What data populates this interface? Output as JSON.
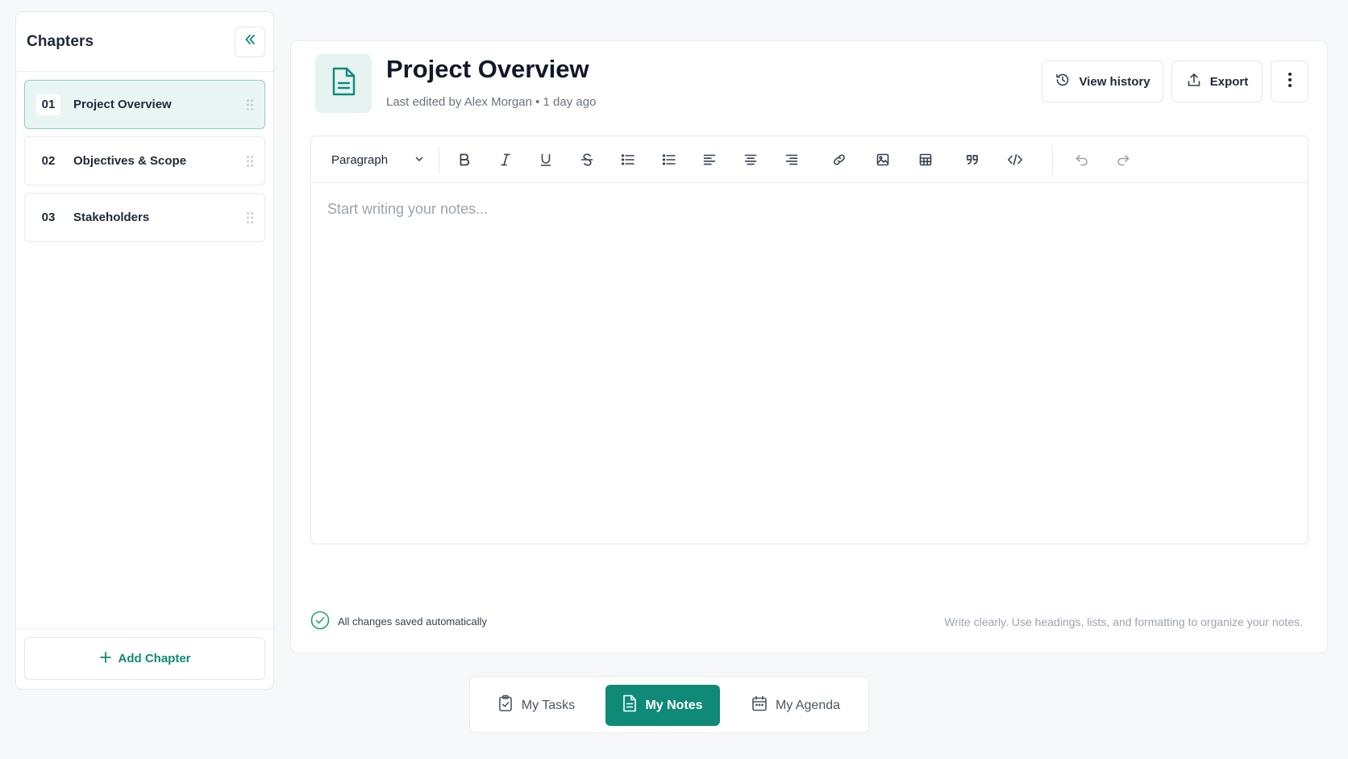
{
  "colors": {
    "accent": "#0f8a78",
    "accent_light": "#e8f5f2",
    "success": "#22a46f"
  },
  "sidebar": {
    "title": "Chapters",
    "collapse_icon": "double-chevron-left-icon",
    "chapters": [
      {
        "num": "01",
        "label": "Project Overview",
        "active": true
      },
      {
        "num": "02",
        "label": "Objectives & Scope",
        "active": false
      },
      {
        "num": "03",
        "label": "Stakeholders",
        "active": false
      }
    ],
    "add_label": "Add Chapter"
  },
  "document": {
    "title": "Project Overview",
    "meta": "Last edited by Alex Morgan • 1 day ago",
    "view_history_label": "View history",
    "export_label": "Export"
  },
  "editor": {
    "block_type": "Paragraph",
    "placeholder": "Start writing your notes...",
    "tools": [
      "bold-icon",
      "italic-icon",
      "underline-icon",
      "strikethrough-icon",
      "bullet-list-icon",
      "numbered-list-icon",
      "align-left-icon",
      "align-center-icon",
      "align-right-icon",
      "link-icon",
      "image-icon",
      "table-icon",
      "quote-icon",
      "code-icon",
      "undo-icon",
      "redo-icon"
    ]
  },
  "status": {
    "saved": "All changes saved automatically",
    "hint": "Write clearly. Use headings, lists, and formatting to organize your notes."
  },
  "bottom_nav": {
    "items": [
      {
        "label": "My Tasks",
        "icon": "clipboard-check-icon",
        "active": false
      },
      {
        "label": "My Notes",
        "icon": "document-icon",
        "active": true
      },
      {
        "label": "My Agenda",
        "icon": "calendar-icon",
        "active": false
      }
    ]
  }
}
